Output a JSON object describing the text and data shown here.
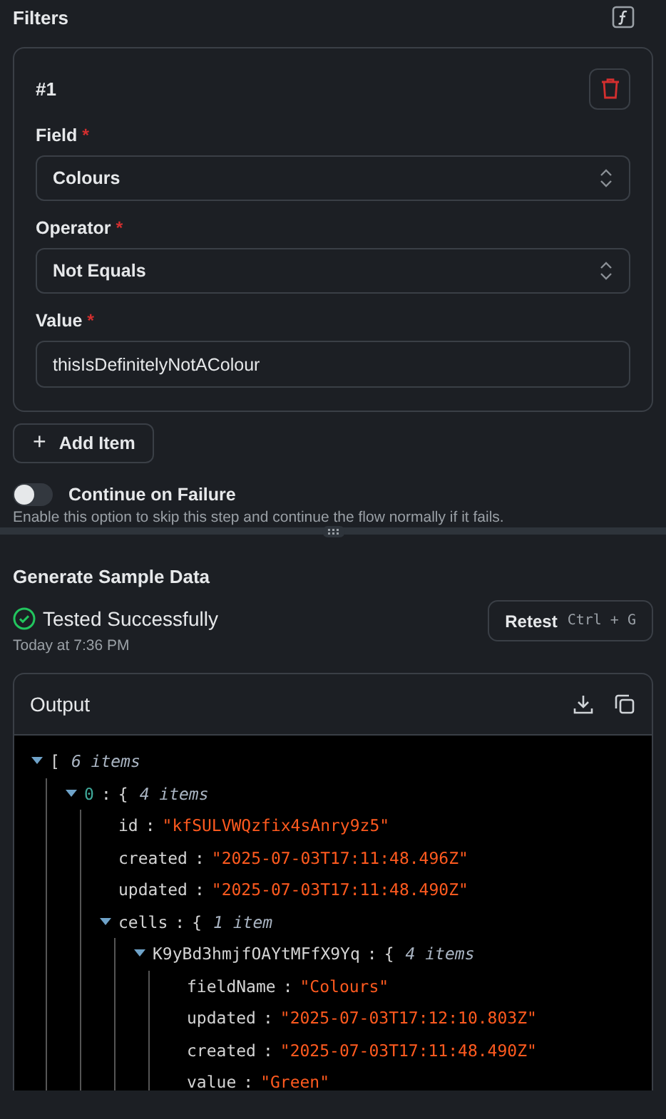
{
  "filters": {
    "title": "Filters",
    "items": [
      {
        "title": "#1",
        "fields": [
          {
            "kind": "select",
            "label": "Field",
            "required_mark": "*",
            "value": "Colours"
          },
          {
            "kind": "select",
            "label": "Operator",
            "required_mark": "*",
            "value": "Not Equals"
          },
          {
            "kind": "text",
            "label": "Value",
            "required_mark": "*",
            "value": "thisIsDefinitelyNotAColour"
          }
        ]
      }
    ],
    "add_button": {
      "icon": "+",
      "label": "Add Item"
    }
  },
  "continue_on_failure": {
    "label": "Continue on Failure",
    "on": false,
    "help": "Enable this option to skip this step and continue the flow normally if it fails."
  },
  "sample": {
    "title": "Generate Sample Data",
    "status": "Tested Successfully",
    "time": "Today at 7:36 PM",
    "retest": {
      "label": "Retest",
      "shortcut": "Ctrl + G"
    },
    "output": {
      "title": "Output",
      "tree": {
        "bracket": "[",
        "count": "6 items",
        "expanded": true,
        "children": [
          {
            "key": "0",
            "sep": ":",
            "bracket": "{",
            "count": "4 items",
            "expanded": true,
            "children": [
              {
                "key": "id",
                "sep": ":",
                "value": "\"kfSULVWQzfix4sAnry9z5\""
              },
              {
                "key": "created",
                "sep": ":",
                "value": "\"2025-07-03T17:11:48.496Z\""
              },
              {
                "key": "updated",
                "sep": ":",
                "value": "\"2025-07-03T17:11:48.490Z\""
              },
              {
                "key": "cells",
                "sep": ":",
                "bracket": "{",
                "count": "1 item",
                "expanded": true,
                "children": [
                  {
                    "key": "K9yBd3hmjfOAYtMFfX9Yq",
                    "sep": ":",
                    "bracket": "{",
                    "count": "4 items",
                    "expanded": true,
                    "children": [
                      {
                        "key": "fieldName",
                        "sep": ":",
                        "value": "\"Colours\""
                      },
                      {
                        "key": "updated",
                        "sep": ":",
                        "value": "\"2025-07-03T17:12:10.803Z\""
                      },
                      {
                        "key": "created",
                        "sep": ":",
                        "value": "\"2025-07-03T17:11:48.490Z\""
                      },
                      {
                        "key": "value",
                        "sep": ":",
                        "value": "\"Green\""
                      }
                    ]
                  }
                ]
              }
            ]
          }
        ]
      }
    }
  }
}
